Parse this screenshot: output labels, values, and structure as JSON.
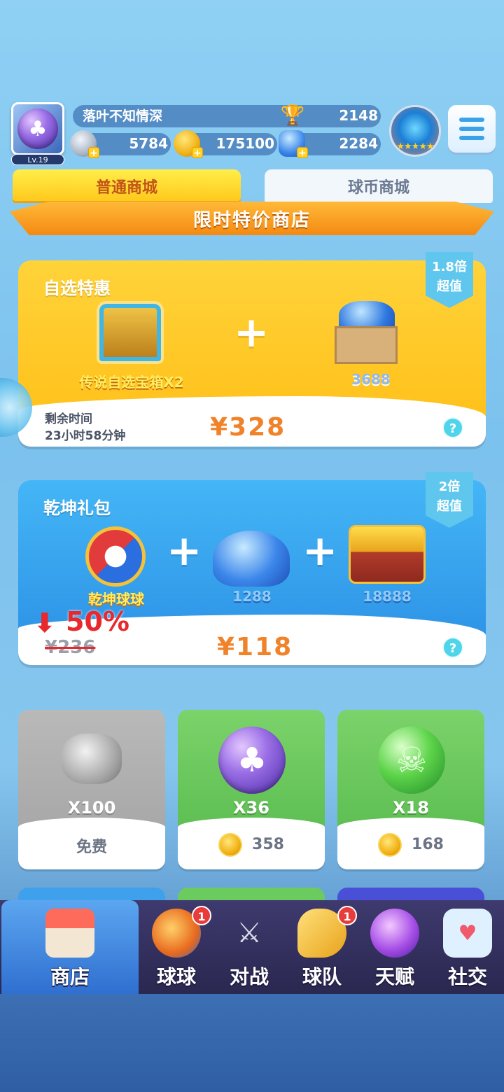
{
  "header": {
    "level": "Lv.19",
    "player_name": "落叶不知情深",
    "trophies": "2148",
    "silver_coins": "5784",
    "gold_coins": "175100",
    "gems": "2284"
  },
  "tabs": [
    {
      "label": "普通商城",
      "active": true
    },
    {
      "label": "球币商城",
      "active": false
    }
  ],
  "banner": {
    "title": "限时特价商店"
  },
  "offer_select": {
    "title": "自选特惠",
    "bonus_line1": "1.8倍",
    "bonus_line2": "超值",
    "item1_label": "传说自选宝箱X2",
    "item2_label": "3688",
    "remaining_label": "剩余时间",
    "remaining_value": "23小时58分钟",
    "price": "¥328",
    "help": "?"
  },
  "offer_qiankun": {
    "title": "乾坤礼包",
    "bonus_line1": "2倍",
    "bonus_line2": "超值",
    "item1_label": "乾坤球球",
    "item2_label": "1288",
    "item3_label": "18888",
    "discount": "50%",
    "old_price": "¥236",
    "price": "¥118",
    "help": "?"
  },
  "shop_items": [
    {
      "qty": "X100",
      "cost": "免费",
      "free": true
    },
    {
      "qty": "X36",
      "cost": "358",
      "free": false
    },
    {
      "qty": "X18",
      "cost": "168",
      "free": false
    }
  ],
  "nav": [
    {
      "label": "商店",
      "active": true,
      "badge": ""
    },
    {
      "label": "球球",
      "active": false,
      "badge": "1"
    },
    {
      "label": "对战",
      "active": false,
      "badge": ""
    },
    {
      "label": "球队",
      "active": false,
      "badge": "1"
    },
    {
      "label": "天赋",
      "active": false,
      "badge": ""
    },
    {
      "label": "社交",
      "active": false,
      "badge": ""
    }
  ],
  "colors": {
    "tab_active": "#ffc61a",
    "card1": "#ffc61a",
    "card2": "#2a8ee4",
    "price": "#f0832a",
    "nav_bg": "#2a2750"
  }
}
